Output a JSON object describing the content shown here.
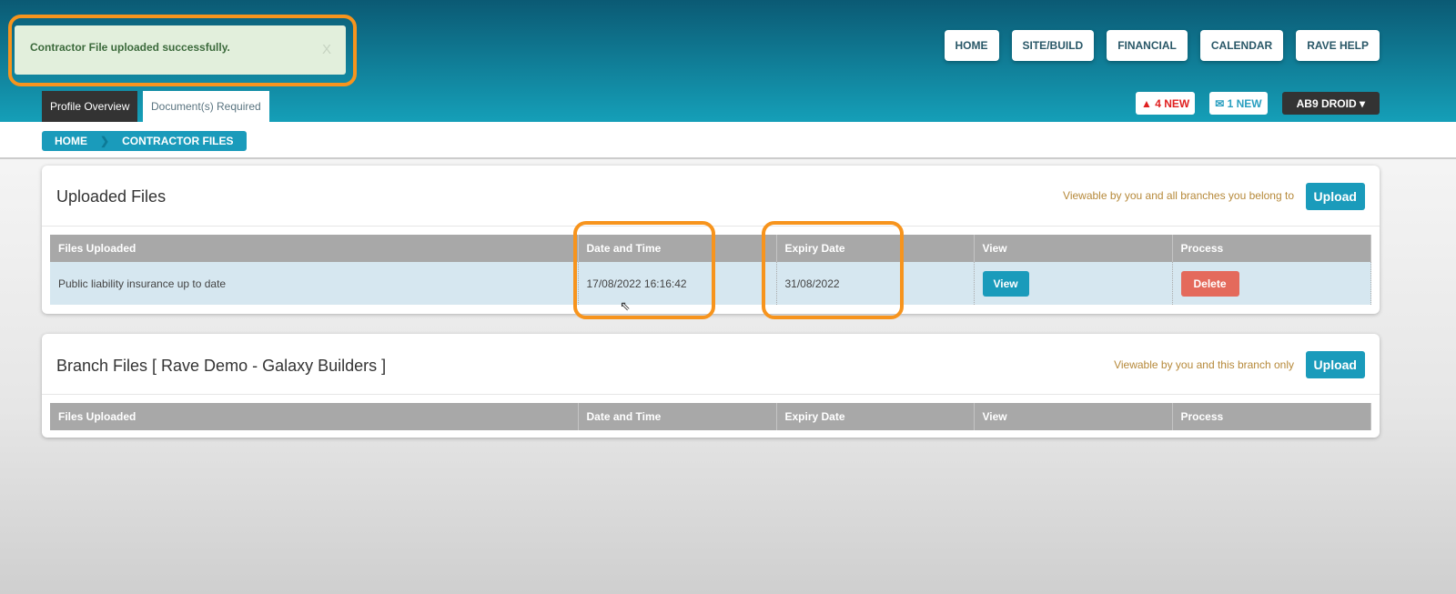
{
  "alert": {
    "message": "Contractor File uploaded successfully.",
    "close": "X"
  },
  "nav": [
    "HOME",
    "SITE/BUILD",
    "FINANCIAL",
    "CALENDAR",
    "RAVE HELP"
  ],
  "tabs": [
    "Profile Overview",
    "Document(s) Required"
  ],
  "badges": {
    "alerts": "4 NEW",
    "messages": "1 NEW",
    "user": "AB9 DROID"
  },
  "breadcrumb": [
    "HOME",
    "CONTRACTOR FILES"
  ],
  "columns": [
    "Files Uploaded",
    "Date and Time",
    "Expiry Date",
    "View",
    "Process"
  ],
  "uploaded": {
    "title": "Uploaded Files",
    "note": "Viewable by you and all branches you belong to",
    "upload": "Upload",
    "rows": [
      {
        "file": "Public liability insurance up to date",
        "datetime": "17/08/2022 16:16:42",
        "expiry": "31/08/2022",
        "view": "View",
        "process": "Delete"
      }
    ]
  },
  "branch": {
    "title": "Branch Files [ Rave Demo - Galaxy Builders ]",
    "note": "Viewable by you and this branch only",
    "upload": "Upload"
  },
  "colors": {
    "accent": "#1a9bbb",
    "highlight": "#f7941d",
    "delete": "#e46a5c"
  }
}
